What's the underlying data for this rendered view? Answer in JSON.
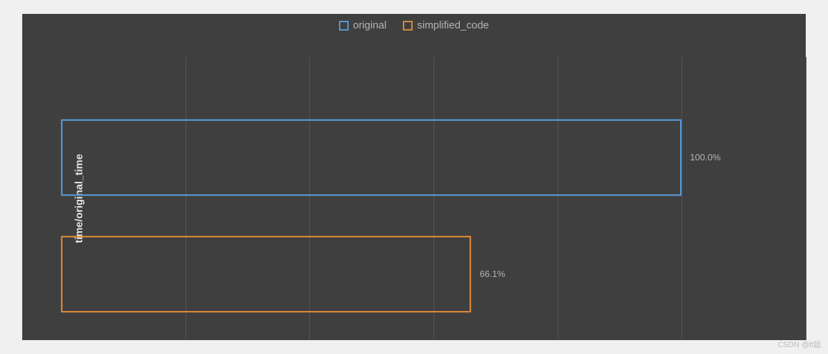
{
  "chart_data": {
    "type": "bar",
    "orientation": "horizontal",
    "ylabel": "time/original_time",
    "xlim": [
      0,
      120
    ],
    "grid_x_ticks": [
      0,
      20,
      40,
      60,
      80,
      100,
      120
    ],
    "series": [
      {
        "name": "original",
        "value": 100.0,
        "label": "100.0%",
        "color": "#5899d4"
      },
      {
        "name": "simplified_code",
        "value": 66.1,
        "label": "66.1%",
        "color": "#d98a3a"
      }
    ],
    "legend": {
      "original": "original",
      "simplified": "simplified_code"
    }
  },
  "watermark": "CSDN @tt姐"
}
